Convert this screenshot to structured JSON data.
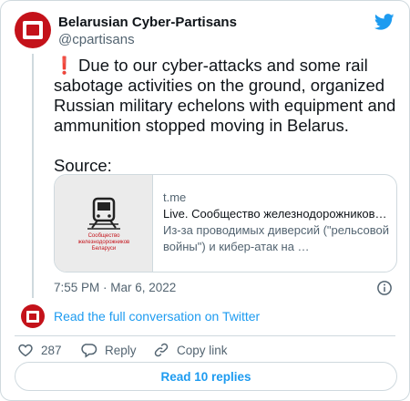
{
  "author": {
    "name": "Belarusian Cyber-Partisans",
    "handle": "@cpartisans"
  },
  "tweet": {
    "line1": "Due to our cyber-attacks and some rail sabotage activities on the ground, organized Russian military echelons with equipment and ammunition stopped moving in Belarus.",
    "line2": "Source:",
    "timestamp": "7:55 PM · Mar 6, 2022"
  },
  "preview": {
    "domain": "t.me",
    "title": "Live. Сообщество железнодорожников…",
    "description": "Из-за проводимых диверсий (\"рельсовой войны\") и кибер-атак на …",
    "image_caption_line1": "Сообщество",
    "image_caption_line2": "железнодорожников",
    "image_caption_line3": "Беларуси"
  },
  "conversation_link": "Read the full conversation on Twitter",
  "actions": {
    "like_count": "287",
    "reply_label": "Reply",
    "copy_label": "Copy link"
  },
  "replies_button": "Read 10 replies",
  "colors": {
    "accent": "#1d9bf0",
    "brand_red": "#c4121a",
    "muted": "#536471",
    "alert": "#e0245e"
  },
  "icons": [
    "twitter-bird-icon",
    "exclamation-icon",
    "train-icon",
    "info-icon",
    "heart-icon",
    "reply-icon",
    "link-icon"
  ]
}
